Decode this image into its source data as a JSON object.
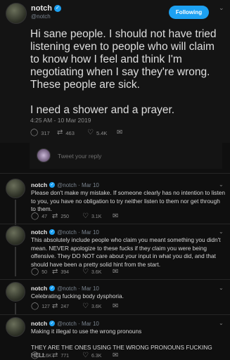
{
  "main_tweet": {
    "name": "notch",
    "handle": "@notch",
    "follow_label": "Following",
    "text": "Hi sane people. I should not have tried listening even to people who will claim to know how I feel and think I'm negotiating when I say they're wrong. These people are sick.\n\nI need a shower and a prayer.",
    "timestamp": "4:25 AM - 10 Mar 2019",
    "replies": "317",
    "retweets": "463",
    "likes": "5.4K"
  },
  "reply_box": {
    "placeholder": "Tweet your reply"
  },
  "replies": [
    {
      "name": "notch",
      "meta": "@notch · Mar 10",
      "paragraphs": [
        "Please don't make my mistake. If someone clearly has no intention to listen to you, you have no obligation to try neither listen to them nor get through to them."
      ],
      "replies": "47",
      "retweets": "250",
      "likes": "3.1K"
    },
    {
      "name": "notch",
      "meta": "@notch · Mar 10",
      "paragraphs": [
        "This absolutely include people who claim you meant something you didn't mean. NEVER apologize to these fucks if they claim you were being offensive. They DO NOT care about your input in what you did, and that should have been a pretty solid hint from the start."
      ],
      "replies": "50",
      "retweets": "394",
      "likes": "3.6K"
    },
    {
      "name": "notch",
      "meta": "@notch · Mar 10",
      "paragraphs": [
        "Celebrating fucking body dysphoria."
      ],
      "replies": "127",
      "retweets": "247",
      "likes": "3.6K"
    },
    {
      "name": "notch",
      "meta": "@notch · Mar 10",
      "paragraphs": [
        "Making it illegal to use the wrong pronouns",
        "THEY ARE THE ONES USING THE WRONG PRONOUNS FUCKING HELL"
      ],
      "replies": "2.6K",
      "retweets": "771",
      "likes": "6.3K"
    }
  ],
  "icons": {
    "reply": "reply-icon",
    "retweet": "retweet-icon",
    "like": "heart-icon",
    "message": "envelope-icon",
    "verified": "verified-badge-icon",
    "more": "chevron-down-icon"
  },
  "colors": {
    "accent": "#1da1f2",
    "background": "#0f0f0f"
  }
}
